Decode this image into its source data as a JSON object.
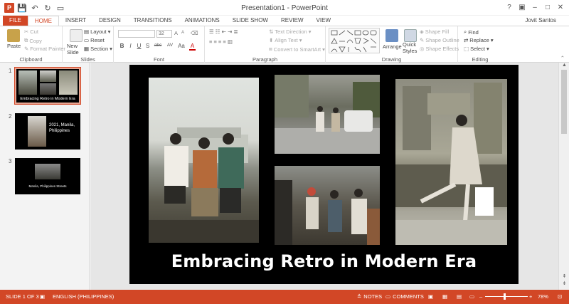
{
  "window": {
    "title": "Presentation1 - PowerPoint",
    "user": "Jovit Santos",
    "controls": [
      "?",
      "▣",
      "–",
      "□",
      "✕"
    ]
  },
  "qat": {
    "logo": "P",
    "save": "💾",
    "undo": "↶",
    "redo": "↻",
    "start": "▭"
  },
  "tabs": [
    "FILE",
    "HOME",
    "INSERT",
    "DESIGN",
    "TRANSITIONS",
    "ANIMATIONS",
    "SLIDE SHOW",
    "REVIEW",
    "VIEW"
  ],
  "ribbon": {
    "clipboard": {
      "label": "Clipboard",
      "paste": "Paste",
      "cut": "Cut",
      "copy": "Copy",
      "format_painter": "Format Painter"
    },
    "slides": {
      "label": "Slides",
      "new_slide": "New Slide",
      "layout": "Layout",
      "reset": "Reset",
      "section": "Section"
    },
    "font": {
      "label": "Font",
      "size": "32",
      "bold": "B",
      "italic": "I",
      "underline": "U",
      "strike": "S",
      "shadow": "abc",
      "spacing": "AV",
      "case": "Aa",
      "color": "A"
    },
    "paragraph": {
      "label": "Paragraph",
      "text_direction": "Text Direction",
      "align_text": "Align Text",
      "convert_smartart": "Convert to SmartArt"
    },
    "drawing": {
      "label": "Drawing",
      "arrange": "Arrange",
      "quick_styles": "Quick Styles",
      "shape_fill": "Shape Fill",
      "shape_outline": "Shape Outline",
      "shape_effects": "Shape Effects"
    },
    "editing": {
      "label": "Editing",
      "find": "Find",
      "replace": "Replace",
      "select": "Select"
    }
  },
  "thumbnails": [
    {
      "num": "1",
      "caption": "Embracing Retro in Modern Era"
    },
    {
      "num": "2",
      "caption": "2021, Manila, Philippines"
    },
    {
      "num": "3",
      "caption": "Manila, Philippines Streets"
    }
  ],
  "slide": {
    "title": "Embracing Retro in Modern Era"
  },
  "statusbar": {
    "slide_info": "SLIDE 1 OF 3",
    "language": "ENGLISH (PHILIPPINES)",
    "notes": "NOTES",
    "comments": "COMMENTS",
    "zoom": "78%",
    "zoom_level": 0.78
  },
  "colors": {
    "accent": "#d24726",
    "slide_bg": "#000000",
    "pane_bg": "#f3f3f3"
  }
}
